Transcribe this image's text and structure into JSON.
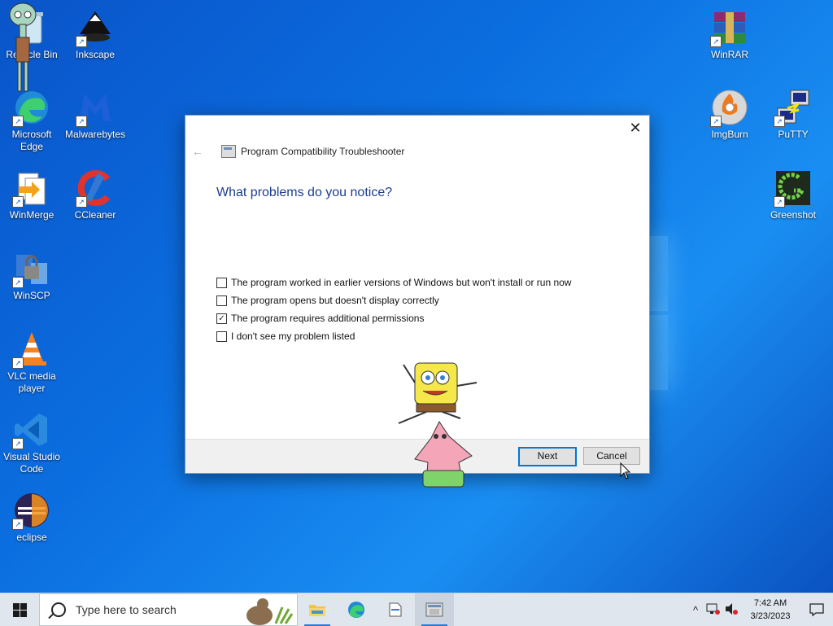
{
  "desktop": {
    "icons_left": [
      {
        "label": "Recycle Bin"
      },
      {
        "label": "Inkscape"
      },
      {
        "label": "Microsoft Edge"
      },
      {
        "label": "Malwarebytes"
      },
      {
        "label": "WinMerge"
      },
      {
        "label": "CCleaner"
      },
      {
        "label": "WinSCP"
      },
      {
        "label": "VLC media player"
      },
      {
        "label": "Visual Studio Code"
      },
      {
        "label": "eclipse"
      }
    ],
    "icons_right": [
      {
        "label": "WinRAR"
      },
      {
        "label": "ImgBurn"
      },
      {
        "label": "PuTTY"
      },
      {
        "label": "Greenshot"
      }
    ]
  },
  "dialog": {
    "title": "Program Compatibility Troubleshooter",
    "question": "What problems do you notice?",
    "close_glyph": "✕",
    "back_glyph": "←",
    "options": [
      {
        "label": "The program worked in earlier versions of Windows but won't install or run now",
        "checked": false
      },
      {
        "label": "The program opens but doesn't display correctly",
        "checked": false
      },
      {
        "label": "The program requires additional permissions",
        "checked": true
      },
      {
        "label": "I don't see my problem listed",
        "checked": false
      }
    ],
    "next_label": "Next",
    "cancel_label": "Cancel"
  },
  "taskbar": {
    "search_placeholder": "Type here to search",
    "time": "7:42 AM",
    "date": "3/23/2023",
    "tray_chevron": "^"
  },
  "colors": {
    "desktop_blue": "#0b6fe0",
    "dialog_heading": "#1c3d8c",
    "accent": "#0078d7"
  }
}
